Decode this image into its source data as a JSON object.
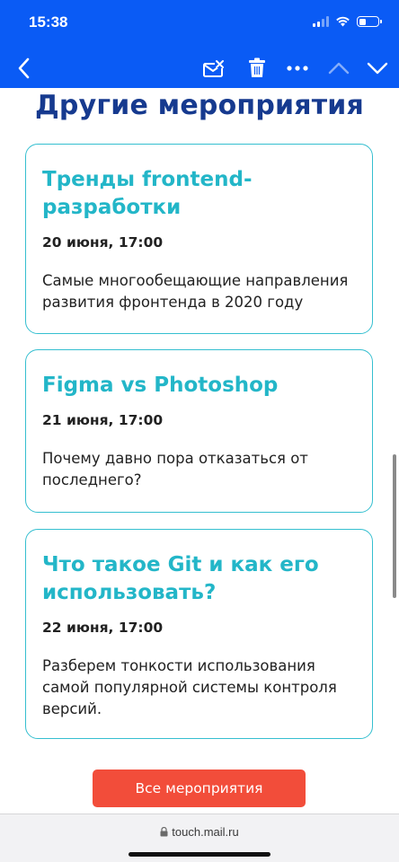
{
  "status_bar": {
    "time": "15:38"
  },
  "toolbar": {
    "icons": [
      "back-icon",
      "unread-mail-icon",
      "trash-icon",
      "more-icon",
      "chevron-up-icon",
      "chevron-down-icon"
    ]
  },
  "page": {
    "title": "Другие мероприятия"
  },
  "events": [
    {
      "title": "Тренды frontend-разработки",
      "date": "20 июня, 17:00",
      "description": "Самые многообещающие направления развития фронтенда в 2020 году"
    },
    {
      "title": "Figma vs Photoshop",
      "date": "21 июня, 17:00",
      "description": "Почему давно пора отказаться от последнего?"
    },
    {
      "title": "Что такое Git и как его использовать?",
      "date": "22 июня, 17:00",
      "description": "Разберем тонкости использования самой популярной системы контроля версий."
    }
  ],
  "all_events_button": "Все мероприятия",
  "address_bar": {
    "url": "touch.mail.ru"
  },
  "colors": {
    "header_bg": "#0a5bf5",
    "title": "#163a8f",
    "accent": "#23b6c8",
    "button": "#f24d3a"
  }
}
